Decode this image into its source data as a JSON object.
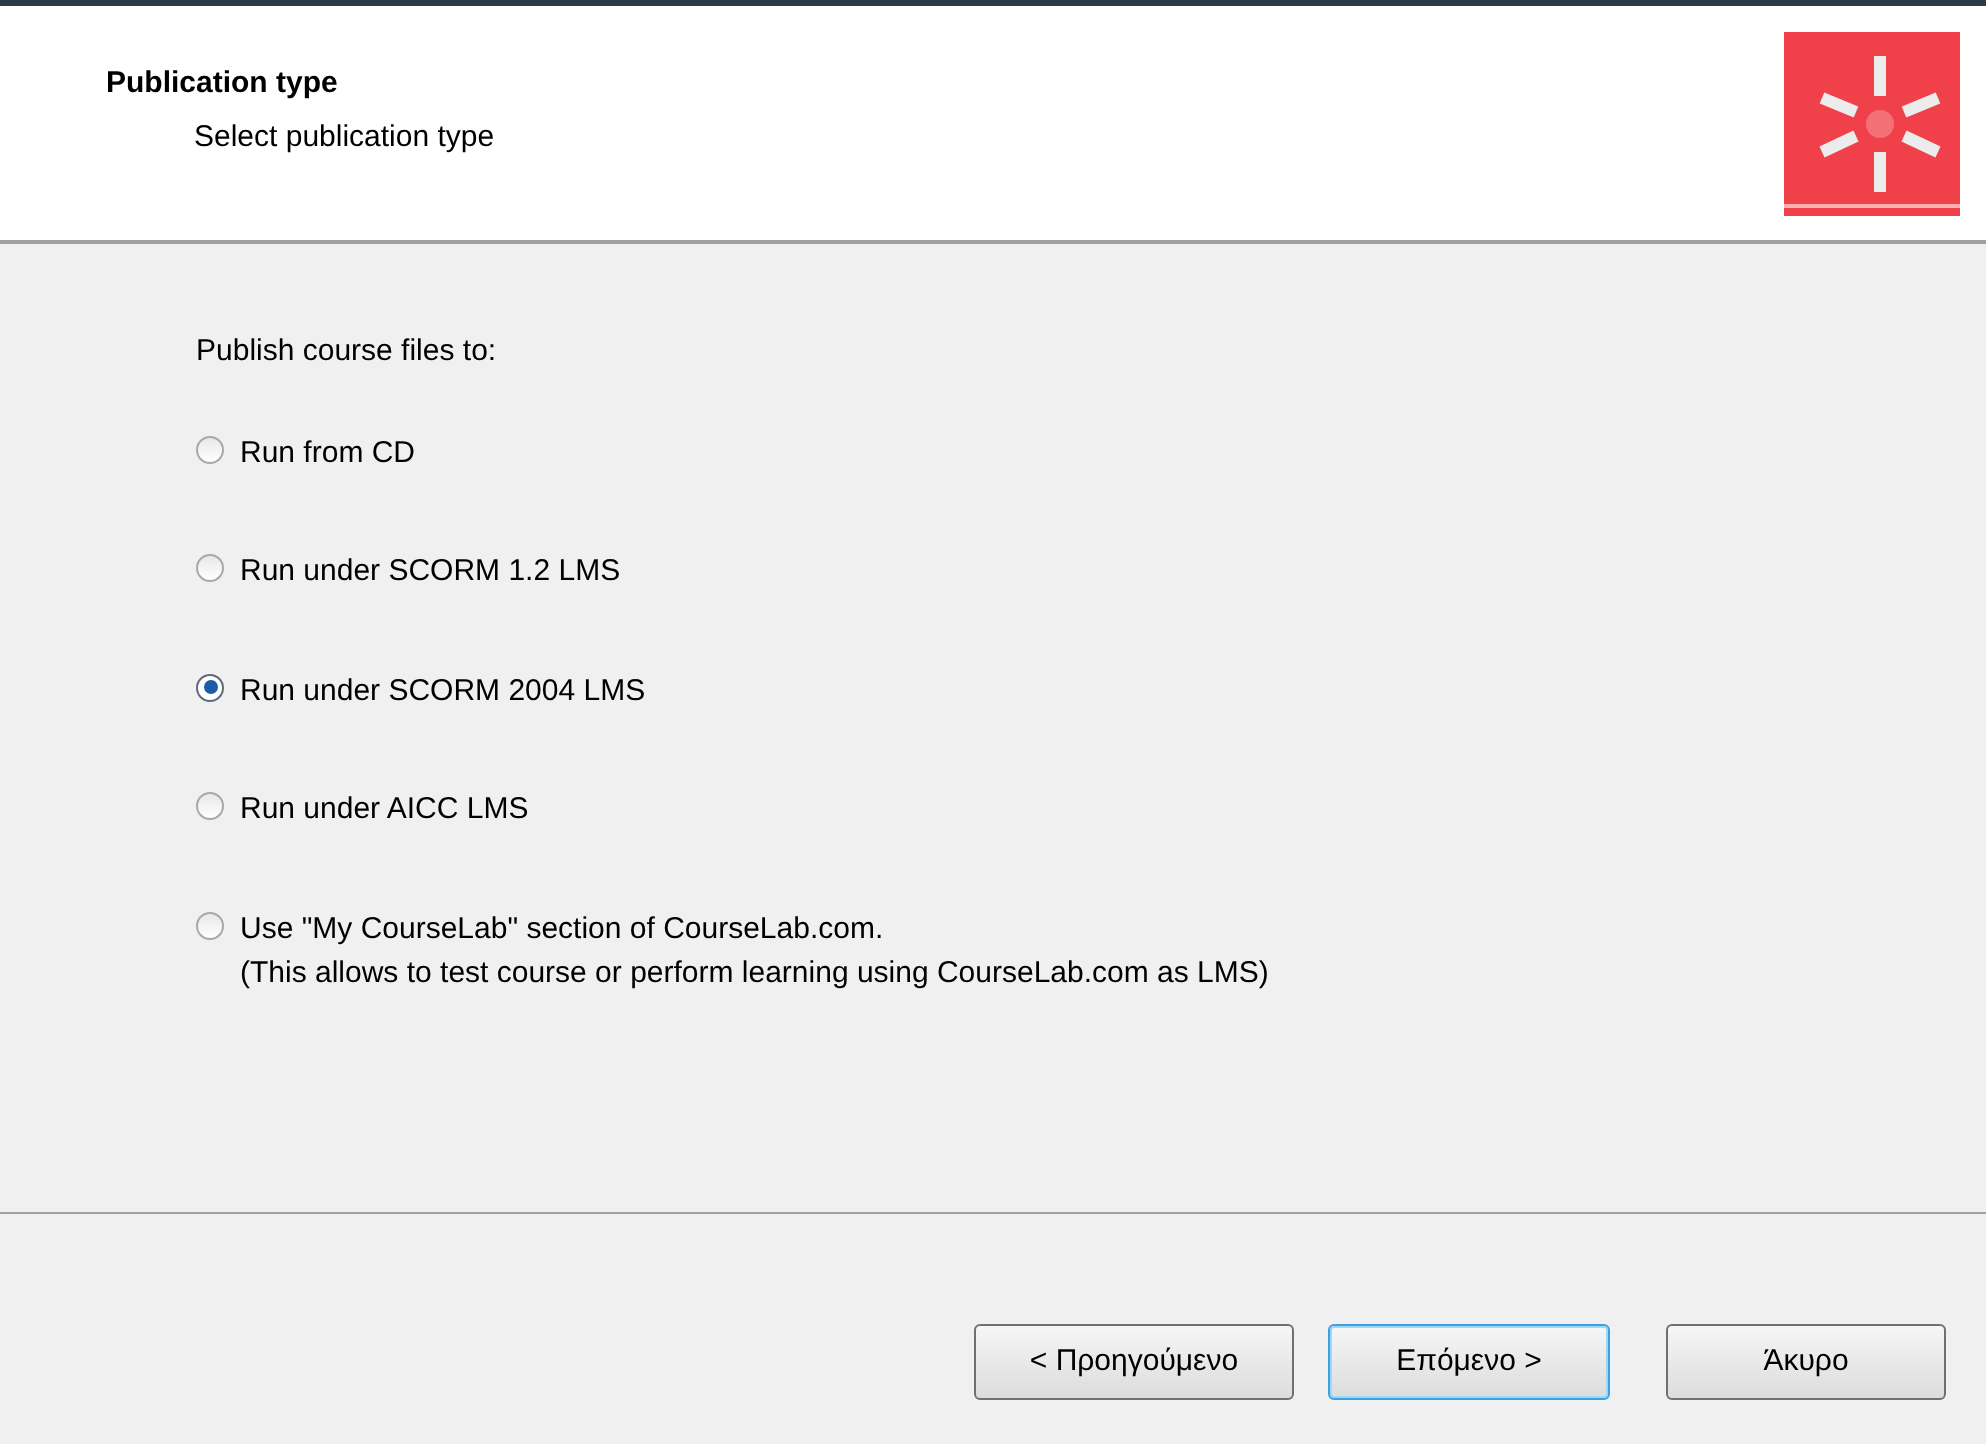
{
  "header": {
    "title": "Publication type",
    "subtitle": "Select publication type"
  },
  "prompt": "Publish course files to:",
  "options": [
    {
      "label": "Run from CD",
      "selected": false
    },
    {
      "label": "Run under SCORM 1.2 LMS",
      "selected": false
    },
    {
      "label": "Run under SCORM 2004 LMS",
      "selected": true
    },
    {
      "label": "Run under AICC LMS",
      "selected": false
    },
    {
      "label": "Use \"My CourseLab\" section of CourseLab.com.",
      "note": "(This allows to test course or perform learning using CourseLab.com as LMS)",
      "selected": false
    }
  ],
  "buttons": [
    {
      "label": "< Προηγούμενο",
      "default": false
    },
    {
      "label": "Επόμενο >",
      "default": true
    },
    {
      "label": "Άκυρο",
      "default": false
    }
  ]
}
